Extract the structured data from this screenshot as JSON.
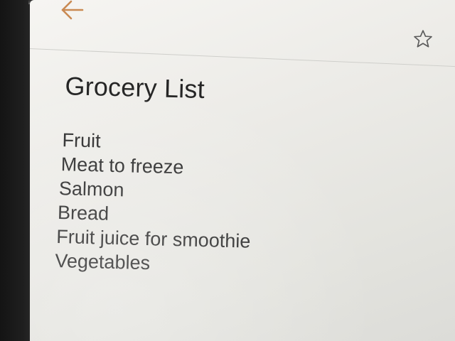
{
  "app_bar": {
    "back_icon": "arrow-left-icon",
    "favorite_icon": "star-outline-icon",
    "accent_color": "#c98a52"
  },
  "note": {
    "title": "Grocery List",
    "lines": [
      "Fruit",
      "Meat to freeze",
      "Salmon",
      "Bread",
      "Fruit juice for smoothie",
      "Vegetables"
    ]
  }
}
